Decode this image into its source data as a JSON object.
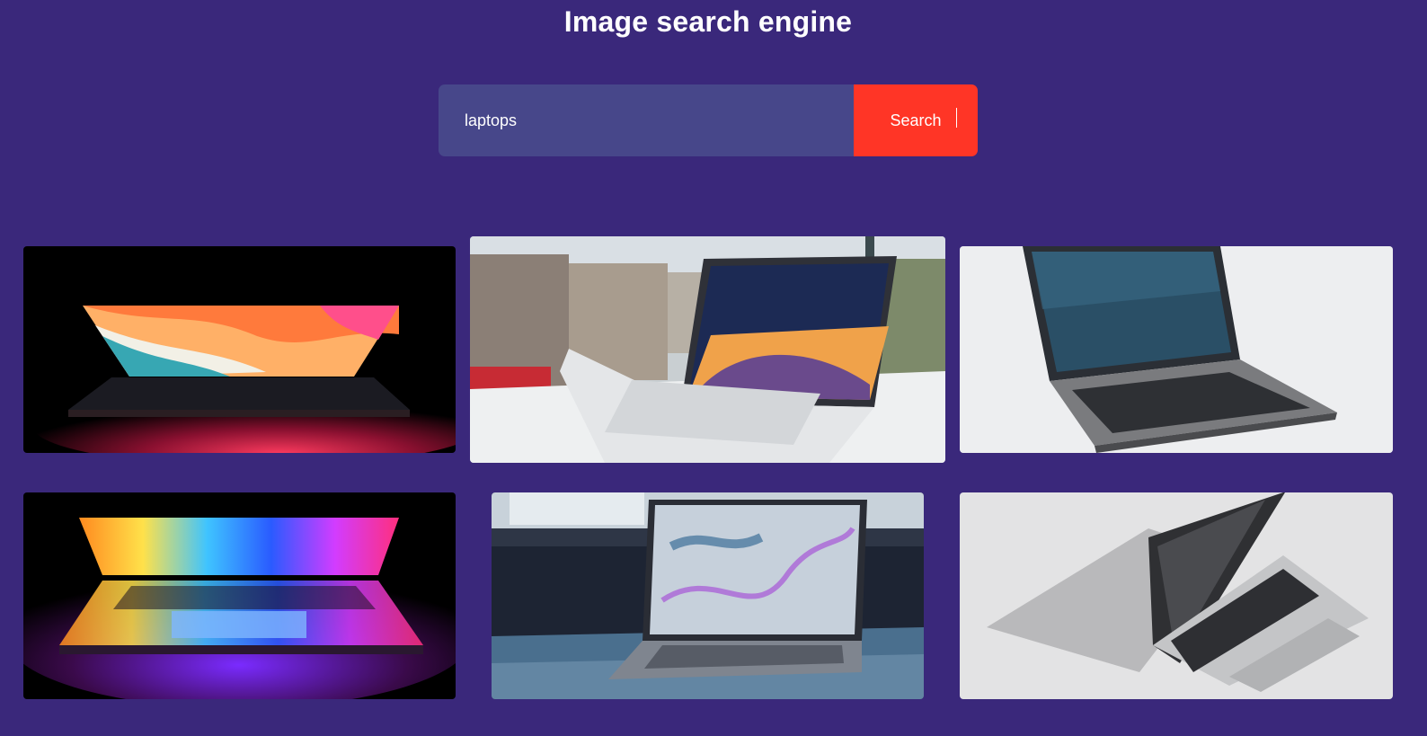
{
  "header": {
    "title": "Image search engine"
  },
  "search": {
    "value": "laptops",
    "button_label": "Search"
  },
  "colors": {
    "background": "#3a287b",
    "input": "#47478a",
    "button": "#ff3526"
  },
  "results": [
    {
      "name": "laptop-neon-wave-screen"
    },
    {
      "name": "silver-laptop-city-window"
    },
    {
      "name": "dell-laptop-white-background"
    },
    {
      "name": "laptop-rainbow-light"
    },
    {
      "name": "laptop-marble-screen-windowsill"
    },
    {
      "name": "silver-laptop-grey-shadow"
    }
  ]
}
